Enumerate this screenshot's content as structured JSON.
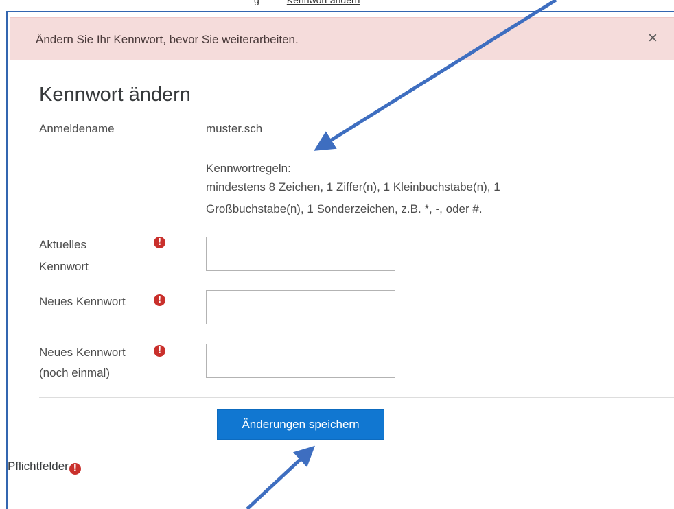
{
  "top_cut": {
    "text_left": "g",
    "text_underlined": "Kennwort ändern"
  },
  "alert": {
    "message": "Ändern Sie Ihr Kennwort, bevor Sie weiterarbeiten.",
    "close_symbol": "×"
  },
  "form": {
    "title": "Kennwort ändern",
    "username_label": "Anmeldename",
    "username_value": "muster.sch",
    "rules_heading": "Kennwortregeln:",
    "rules_line1": "mindestens 8 Zeichen, 1 Ziffer(n), 1 Kleinbuchstabe(n), 1",
    "rules_line2": "Großbuchstabe(n), 1 Sonderzeichen, z.B. *, -, oder #.",
    "current_label_line1": "Aktuelles",
    "current_label_line2": "Kennwort",
    "current_value": "",
    "new_label": "Neues Kennwort",
    "new_value": "",
    "repeat_label_line1": "Neues Kennwort",
    "repeat_label_line2": "(noch einmal)",
    "repeat_value": "",
    "required_icon": "!",
    "save_label": "Änderungen speichern",
    "required_note": "Pflichtfelder"
  },
  "colors": {
    "alert_bg": "#f5dcdb",
    "primary": "#1177d1",
    "required": "#c9302c",
    "annotation_arrow": "#3e6ec0"
  }
}
